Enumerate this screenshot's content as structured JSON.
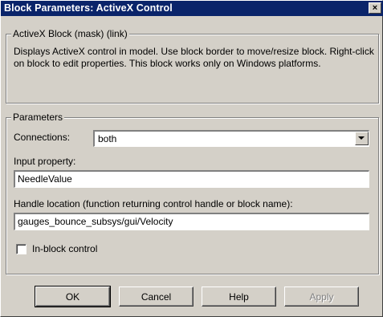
{
  "window": {
    "title": "Block Parameters: ActiveX Control",
    "close_glyph": "×"
  },
  "mask_group": {
    "legend": "ActiveX Block (mask) (link)",
    "description": "Displays ActiveX control in model. Use block border to move/resize block. Right-click on block to edit properties. This block works only on Windows platforms."
  },
  "parameters_group": {
    "legend": "Parameters",
    "connections_label": "Connections:",
    "connections_value": "both",
    "input_property_label": "Input property:",
    "input_property_value": "NeedleValue",
    "handle_location_label": "Handle location (function returning control handle or block name):",
    "handle_location_value": "gauges_bounce_subsys/gui/Velocity",
    "inblock_control_label": "In-block control",
    "inblock_control_checked": false
  },
  "buttons": {
    "ok": "OK",
    "cancel": "Cancel",
    "help": "Help",
    "apply": "Apply"
  },
  "colors": {
    "titlebar": "#0a246a",
    "dialog_face": "#d4d0c8"
  }
}
